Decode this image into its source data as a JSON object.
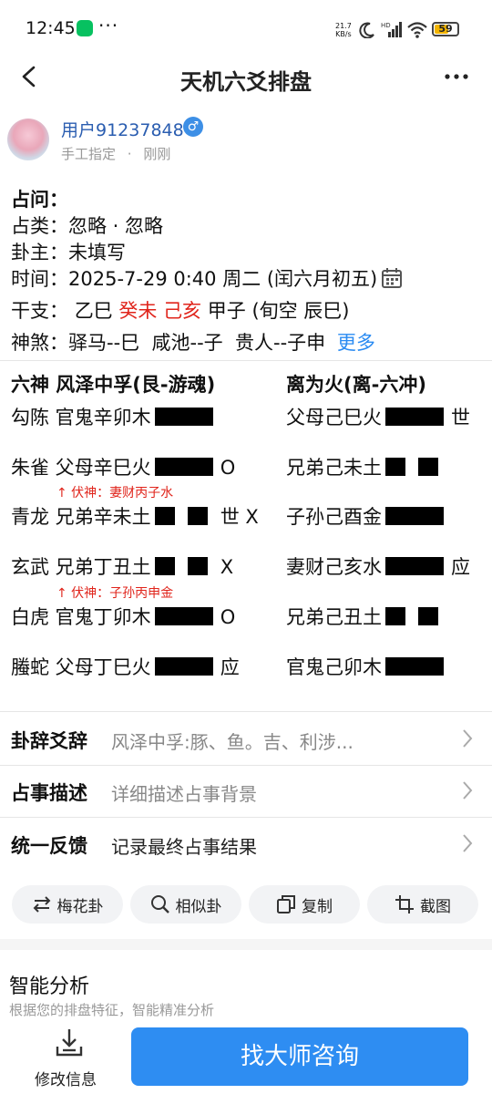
{
  "status": {
    "time": "12:45",
    "dots": "···",
    "speed_value": "21.7",
    "speed_unit": "KB/s",
    "battery": "59"
  },
  "header": {
    "title": "天机六爻排盘"
  },
  "user": {
    "name": "用户91237848",
    "gender_symbol": "♂",
    "method": "手工指定",
    "sep": "·",
    "when": "刚刚"
  },
  "info": {
    "question_label": "占问：",
    "question": "",
    "category_label": "占类：",
    "category": "忽略 · 忽略",
    "owner_label": "卦主：",
    "owner": "未填写",
    "time_label": "时间：",
    "time": "2025-7-29 0:40 周二 (闰六月初五)",
    "ganzhi_label": "干支：",
    "gz1": "乙巳",
    "gz2": "癸未",
    "gz3": "己亥",
    "gz4": "甲子",
    "xunkong": "(旬空 辰巳)",
    "shensha_label": "神煞：",
    "shensha": "驿马--巳  咸池--子  贵人--子申",
    "more": "更多"
  },
  "hexagram": {
    "left_header": "六神 风泽中孚(艮-游魂)",
    "right_header": "离为火(离-六冲)",
    "left_rows": [
      {
        "text": "勾陈 官鬼辛卯木",
        "line": "yang",
        "mark": ""
      },
      {
        "text": "朱雀 父母辛巳火",
        "line": "yang",
        "mark": "O"
      },
      {
        "text": "青龙 兄弟辛未土",
        "line": "yin",
        "mark": "世 X"
      },
      {
        "text": "玄武 兄弟丁丑土",
        "line": "yin",
        "mark": "X"
      },
      {
        "text": "白虎 官鬼丁卯木",
        "line": "yang",
        "mark": "O"
      },
      {
        "text": "螣蛇 父母丁巳火",
        "line": "yang",
        "mark": "应"
      }
    ],
    "right_rows": [
      {
        "text": "父母己巳火",
        "line": "yang",
        "mark": "世"
      },
      {
        "text": "兄弟己未土",
        "line": "yin",
        "mark": ""
      },
      {
        "text": "子孙己酉金",
        "line": "yang",
        "mark": ""
      },
      {
        "text": "妻财己亥水",
        "line": "yang",
        "mark": "应"
      },
      {
        "text": "兄弟己丑土",
        "line": "yin",
        "mark": ""
      },
      {
        "text": "官鬼己卯木",
        "line": "yang",
        "mark": ""
      }
    ],
    "fushen": [
      "↑ 伏神：妻财丙子水",
      "↑ 伏神：子孙丙申金"
    ]
  },
  "menu": [
    {
      "label": "卦辞爻辞",
      "value": "风泽中孚:豚、鱼。吉、利涉..."
    },
    {
      "label": "占事描述",
      "value": "详细描述占事背景"
    },
    {
      "label": "统一反馈",
      "value": "记录最终占事结果"
    }
  ],
  "actions": [
    {
      "label": "梅花卦",
      "icon": "swap-icon"
    },
    {
      "label": "相似卦",
      "icon": "search-icon"
    },
    {
      "label": "复制",
      "icon": "copy-icon"
    },
    {
      "label": "截图",
      "icon": "crop-icon"
    }
  ],
  "ai": {
    "title": "智能分析",
    "subtitle": "根据您的排盘特征，智能精准分析"
  },
  "bottom": {
    "edit_label": "修改信息",
    "cta": "找大师咨询"
  },
  "colors": {
    "accent": "#2e8df2",
    "red": "#e0241b",
    "link": "#2a8bf2"
  }
}
